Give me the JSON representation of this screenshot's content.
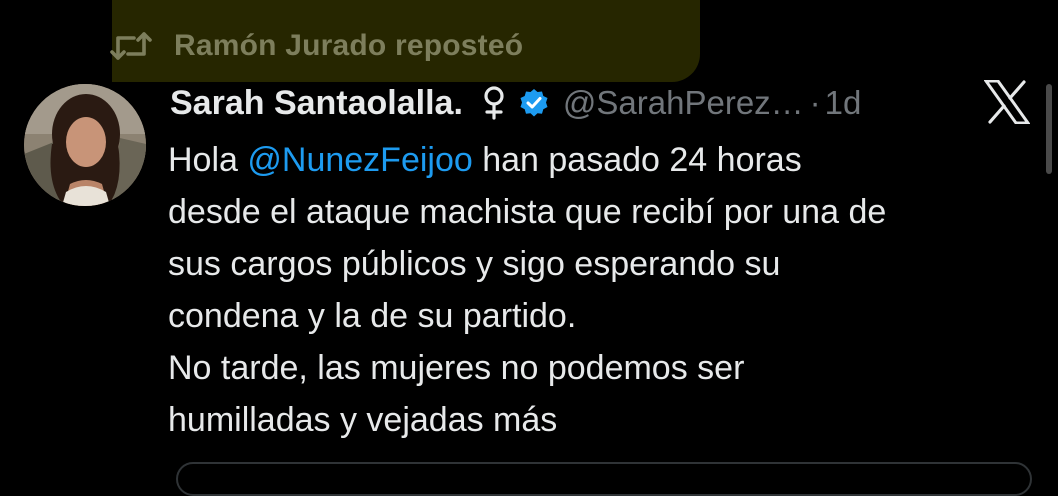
{
  "repost": {
    "icon": "repost-icon",
    "text": "Ramón Jurado reposteó",
    "highlight_color": "#2a2a00",
    "text_color": "#7d7e5c"
  },
  "tweet": {
    "avatar": "avatar-photo",
    "display_name": "Sarah Santaolalla.",
    "name_symbol": "venus-icon",
    "verified": "verified-badge-icon",
    "handle": "@SarahPerez…",
    "separator": "·",
    "time": "1d",
    "platform_logo": "x-logo-icon",
    "body": {
      "line1_pre": "Hola ",
      "mention": "@NunezFeijoo",
      "line1_post": " han pasado 24 horas",
      "line2": "desde el ataque machista que recibí por una de",
      "line3": "sus cargos públicos y sigo esperando su",
      "line4": "condena y la de su partido.",
      "line5": "No tarde, las mujeres no podemos ser",
      "line6": "humilladas y vejadas más"
    }
  },
  "colors": {
    "background": "#000000",
    "text_primary": "#e7e9ea",
    "text_secondary": "#71767b",
    "link": "#1d9bf0",
    "verified": "#1d9bf0"
  }
}
